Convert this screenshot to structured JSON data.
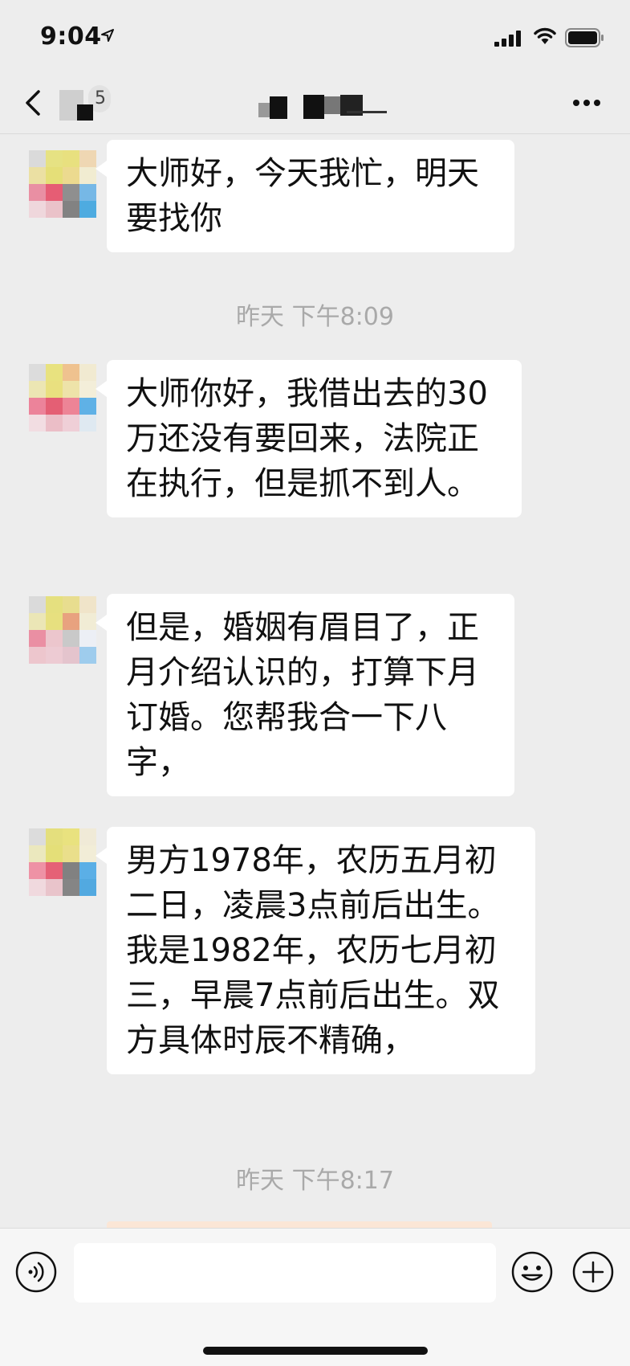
{
  "status_bar": {
    "time": "9:04"
  },
  "nav": {
    "subtitle_fragment": "5"
  },
  "messages": [
    {
      "type": "text",
      "text": "大师好，今天我忙，明天要找你"
    },
    {
      "type": "timestamp",
      "text": "昨天 下午8:09"
    },
    {
      "type": "text",
      "text": "大师你好，我借出去的30万还没有要回来，法院正在执行，但是抓不到人。"
    },
    {
      "type": "text",
      "text": "但是，婚姻有眉目了，正月介绍认识的，打算下月订婚。您帮我合一下八字，"
    },
    {
      "type": "text",
      "text": "男方1978年，农历五月初二日，凌晨3点前后出生。我是1982年，农历七月初三，早晨7点前后出生。双方具体时辰不精确，"
    },
    {
      "type": "timestamp",
      "text": "昨天 下午8:17"
    }
  ],
  "input": {
    "value": "",
    "placeholder": ""
  },
  "icons": {
    "back": "chevron-left-icon",
    "more": "ellipsis-icon",
    "voice": "voice-icon",
    "emoji": "emoji-icon",
    "plus": "plus-icon"
  },
  "colors": {
    "background": "#ededed",
    "bubble": "#ffffff",
    "timestamp_text": "#a9a9a9"
  }
}
